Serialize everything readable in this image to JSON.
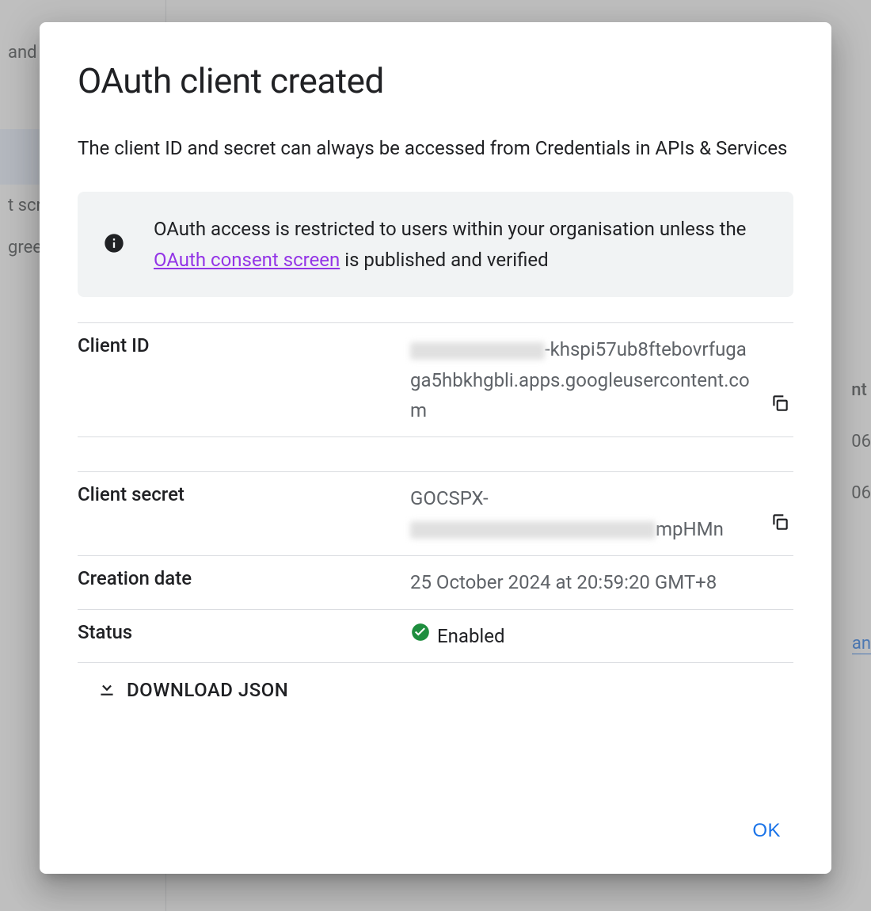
{
  "background": {
    "sidebar": {
      "item1_partial": "and s",
      "item3_partial": "t scre",
      "item4_partial": "green"
    },
    "right": {
      "header_partial": "nt",
      "val1_partial": "06",
      "val2_partial": "06",
      "link_partial": "an"
    }
  },
  "modal": {
    "title": "OAuth client created",
    "subtitle": "The client ID and secret can always be accessed from Credentials in APIs & Services",
    "banner": {
      "text_before": "OAuth access is restricted to users within your organisation unless the ",
      "link": "OAuth consent screen",
      "text_after": " is published and verified"
    },
    "fields": {
      "client_id": {
        "label": "Client ID",
        "value_visible_suffix": "-khspi57ub8ftebovrfugaga5hbkhgbli.apps.googleusercontent.com"
      },
      "client_secret": {
        "label": "Client secret",
        "value_prefix": "GOCSPX-",
        "value_visible_suffix": "mpHMn"
      },
      "creation_date": {
        "label": "Creation date",
        "value": "25 October 2024 at 20:59:20 GMT+8"
      },
      "status": {
        "label": "Status",
        "value": "Enabled"
      }
    },
    "download_label": "DOWNLOAD JSON",
    "ok_label": "OK"
  }
}
